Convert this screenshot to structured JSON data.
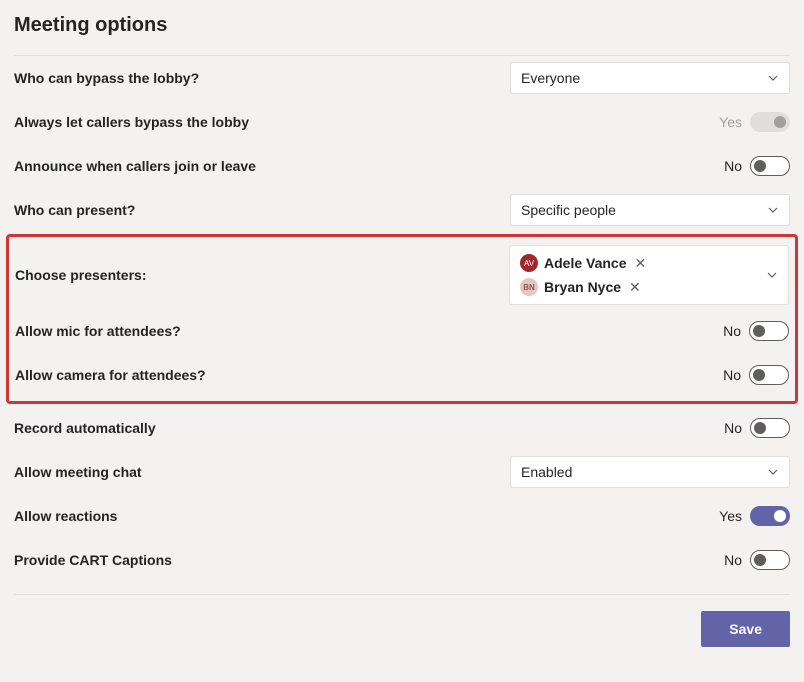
{
  "title": "Meeting options",
  "rows": {
    "bypass_lobby": {
      "label": "Who can bypass the lobby?",
      "value": "Everyone"
    },
    "callers_bypass": {
      "label": "Always let callers bypass the lobby",
      "state_label": "Yes",
      "enabled": false
    },
    "announce_callers": {
      "label": "Announce when callers join or leave",
      "state_label": "No",
      "on": false
    },
    "who_present": {
      "label": "Who can present?",
      "value": "Specific people"
    },
    "choose_presenters": {
      "label": "Choose presenters:",
      "people": [
        {
          "name": "Adele Vance",
          "initials": "AV"
        },
        {
          "name": "Bryan Nyce",
          "initials": "BN"
        }
      ]
    },
    "allow_mic": {
      "label": "Allow mic for attendees?",
      "state_label": "No",
      "on": false
    },
    "allow_camera": {
      "label": "Allow camera for attendees?",
      "state_label": "No",
      "on": false
    },
    "record_auto": {
      "label": "Record automatically",
      "state_label": "No",
      "on": false
    },
    "allow_chat": {
      "label": "Allow meeting chat",
      "value": "Enabled"
    },
    "allow_reactions": {
      "label": "Allow reactions",
      "state_label": "Yes",
      "on": true
    },
    "cart_captions": {
      "label": "Provide CART Captions",
      "state_label": "No",
      "on": false
    }
  },
  "buttons": {
    "save": "Save"
  }
}
